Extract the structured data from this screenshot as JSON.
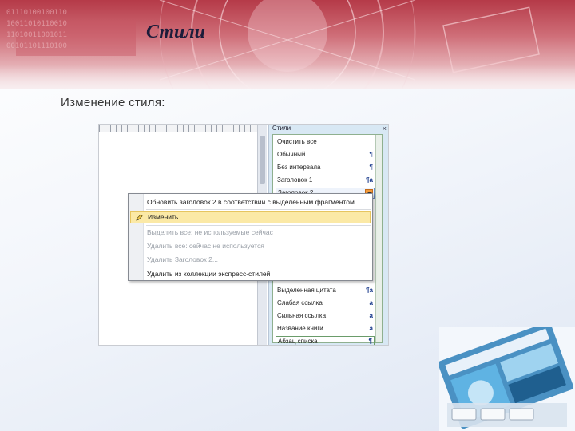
{
  "slide": {
    "title": "Стили",
    "subtitle": "Изменение стиля:"
  },
  "styles_pane": {
    "header": "Стили",
    "close_glyph": "×",
    "items": [
      {
        "label": "Очистить все",
        "mark": ""
      },
      {
        "label": "Обычный",
        "mark": "¶"
      },
      {
        "label": "Без интервала",
        "mark": "¶"
      },
      {
        "label": "Заголовок 1",
        "mark": "¶a"
      },
      {
        "label": "Заголовок 2",
        "mark": ""
      },
      {
        "label": "Выделенная цитата",
        "mark": "¶a"
      },
      {
        "label": "Слабая ссылка",
        "mark": "a"
      },
      {
        "label": "Сильная ссылка",
        "mark": "a"
      },
      {
        "label": "Название книги",
        "mark": "a"
      },
      {
        "label": "Абзац списка",
        "mark": "¶"
      }
    ]
  },
  "context_menu": {
    "items": [
      {
        "label": "Обновить заголовок 2 в соответствии с выделенным фрагментом",
        "state": "normal"
      },
      {
        "label": "Изменить...",
        "state": "highlighted",
        "icon": "edit-icon"
      },
      {
        "label": "Выделить все: не используемые сейчас",
        "state": "disabled"
      },
      {
        "label": "Удалить все: сейчас не используется",
        "state": "disabled"
      },
      {
        "label": "Удалить Заголовок 2...",
        "state": "disabled"
      },
      {
        "label": "Удалить из коллекции экспресс-стилей",
        "state": "normal"
      }
    ]
  },
  "colors": {
    "banner": "#b53a48",
    "menu_highlight": "#fbe9a6",
    "pane_background": "#d8e8f4"
  }
}
